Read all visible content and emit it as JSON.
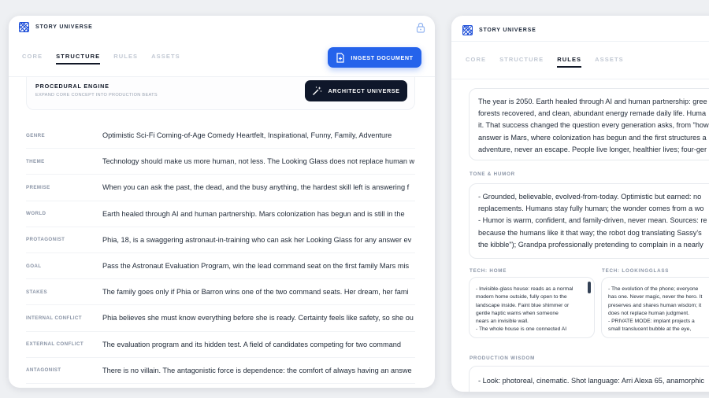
{
  "left": {
    "brand": "STORY UNIVERSE",
    "tabs": [
      {
        "label": "CORE",
        "active": false
      },
      {
        "label": "STRUCTURE",
        "active": true
      },
      {
        "label": "RULES",
        "active": false
      },
      {
        "label": "ASSETS",
        "active": false
      }
    ],
    "ingest_button": "INGEST DOCUMENT",
    "engine": {
      "title": "PROCEDURAL ENGINE",
      "subtitle": "EXPAND CORE CONCEPT INTO PRODUCTION BEATS",
      "button": "ARCHITECT UNIVERSE"
    },
    "rows": [
      {
        "label": "GENRE",
        "value": "Optimistic Sci-Fi Coming-of-Age Comedy Heartfelt, Inspirational, Funny, Family, Adventure"
      },
      {
        "label": "THEME",
        "value": "Technology should make us more human, not less. The Looking Glass does not replace human w"
      },
      {
        "label": "PREMISE",
        "value": "When you can ask the past, the dead, and the busy anything, the hardest skill left is answering f"
      },
      {
        "label": "WORLD",
        "value": "Earth healed through AI and human partnership. Mars colonization has begun and is still in the"
      },
      {
        "label": "PROTAGONIST",
        "value": "Phia, 18, is a swaggering astronaut-in-training who can ask her Looking Glass for any answer ev"
      },
      {
        "label": "GOAL",
        "value": "Pass the Astronaut Evaluation Program, win the lead command seat on the first family Mars mis"
      },
      {
        "label": "STAKES",
        "value": "The family goes only if Phia or Barron wins one of the two command seats. Her dream, her fami"
      },
      {
        "label": "INTERNAL CONFLICT",
        "value": "Phia believes she must know everything before she is ready. Certainty feels like safety, so she ou"
      },
      {
        "label": "EXTERNAL CONFLICT",
        "value": "The evaluation program and its hidden test. A field of candidates competing for two command"
      },
      {
        "label": "ANTAGONIST",
        "value": "There is no villain. The antagonistic force is dependence: the comfort of always having an answe"
      }
    ]
  },
  "right": {
    "brand": "STORY UNIVERSE",
    "tabs": [
      {
        "label": "CORE",
        "active": false
      },
      {
        "label": "STRUCTURE",
        "active": false
      },
      {
        "label": "RULES",
        "active": true
      },
      {
        "label": "ASSETS",
        "active": false
      }
    ],
    "world_lines": [
      "The year is 2050. Earth healed through AI and human partnership: gree",
      "forests recovered, and clean, abundant energy remade daily life. Huma",
      "it. That success changed the question every generation asks, from \"how",
      "answer is Mars, where colonization has begun and the first structures a",
      "adventure, never an escape. People live longer, healthier lives; four-ger"
    ],
    "tone_label": "TONE & HUMOR",
    "tone_lines": [
      "- Grounded, believable, evolved-from-today. Optimistic but earned: no",
      "replacements. Humans stay fully human; the wonder comes from a wo",
      "- Humor is warm, confident, and family-driven, never mean. Sources: re",
      "because the humans like it that way; the robot dog translating Sassy's",
      "the kibble\"); Grandpa professionally pretending to complain in a nearly"
    ],
    "tech_home_label": "TECH: HOME",
    "tech_home_lines": [
      "- Invisible-glass house: reads as a normal",
      "modern home outside, fully open to the",
      "landscape inside. Faint blue shimmer or",
      "gentle haptic warns when someone",
      "nears an invisible wall.",
      "- The whole house is one connected AI"
    ],
    "tech_glass_label": "TECH: LOOKINGGLASS",
    "tech_glass_lines": [
      "- The evolution of the phone; everyone",
      "has one. Never magic, never the hero. It",
      "preserves and shares human wisdom; it",
      "does not replace human judgment.",
      "- PRIVATE MODE: implant projects a",
      "small translucent bubble at the eye,"
    ],
    "wisdom_label": "PRODUCTION WISDOM",
    "wisdom_line": "- Look: photoreal, cinematic. Shot language: Arri Alexa 65, anamorphic"
  }
}
